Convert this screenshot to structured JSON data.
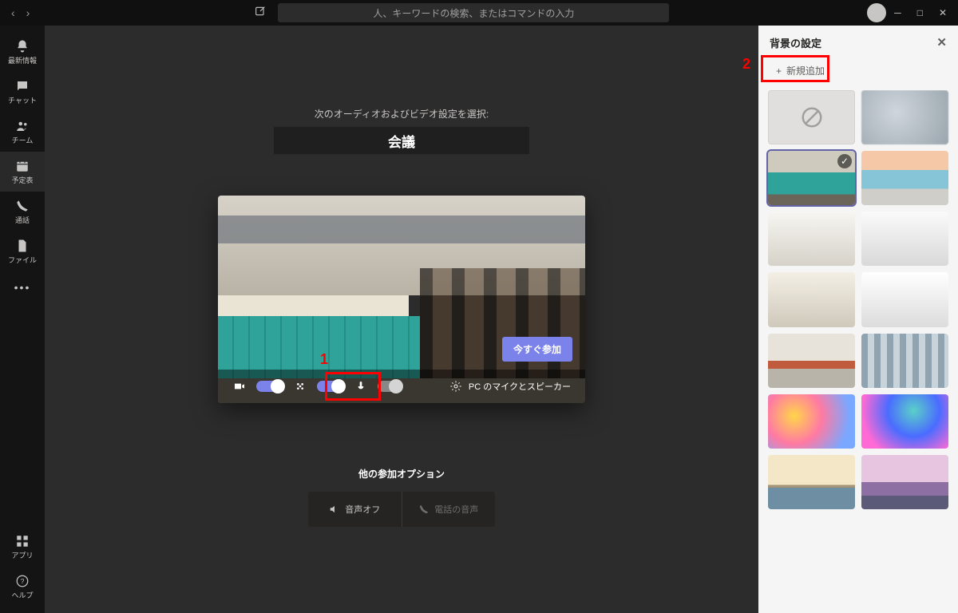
{
  "titlebar": {
    "search_placeholder": "人、キーワードの検索、またはコマンドの入力"
  },
  "rail": {
    "items": [
      {
        "label": "最新情報",
        "icon": "bell"
      },
      {
        "label": "チャット",
        "icon": "chat"
      },
      {
        "label": "チーム",
        "icon": "team"
      },
      {
        "label": "予定表",
        "icon": "calendar",
        "active": true
      },
      {
        "label": "通話",
        "icon": "call"
      },
      {
        "label": "ファイル",
        "icon": "file"
      }
    ],
    "bottom": [
      {
        "label": "アプリ",
        "icon": "apps"
      },
      {
        "label": "ヘルプ",
        "icon": "help"
      }
    ]
  },
  "meeting": {
    "prompt": "次のオーディオおよびビデオ設定を選択:",
    "name": "会議",
    "join_label": "今すぐ参加",
    "device_label": "PC のマイクとスピーカー",
    "other_options_title": "他の参加オプション",
    "audio_off": "音声オフ",
    "phone_audio": "電話の音声"
  },
  "panel": {
    "title": "背景の設定",
    "add_new": "新規追加"
  },
  "annotations": {
    "one": "1",
    "two": "2"
  },
  "backgrounds": [
    {
      "kind": "none"
    },
    {
      "kind": "blur"
    },
    {
      "kind": "office1",
      "selected": true
    },
    {
      "kind": "office2"
    },
    {
      "kind": "room1"
    },
    {
      "kind": "room2"
    },
    {
      "kind": "room3"
    },
    {
      "kind": "room4"
    },
    {
      "kind": "office3"
    },
    {
      "kind": "office4"
    },
    {
      "kind": "art1"
    },
    {
      "kind": "art2"
    },
    {
      "kind": "bridge"
    },
    {
      "kind": "mountain"
    }
  ]
}
